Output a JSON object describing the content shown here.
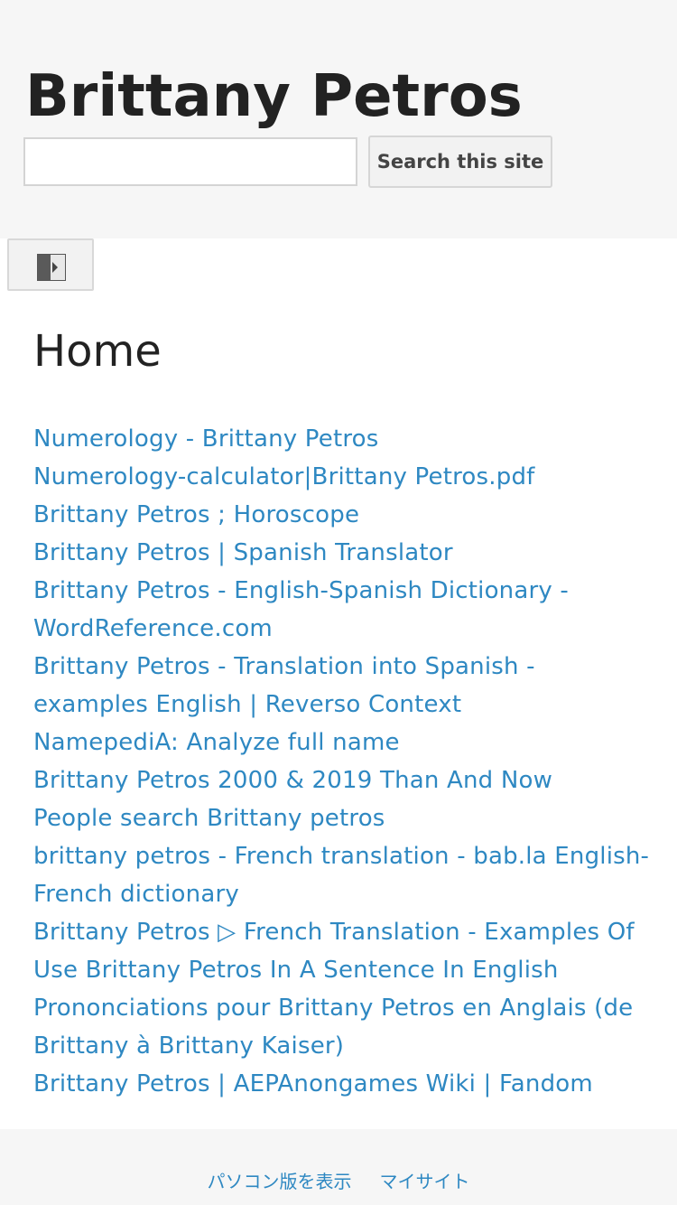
{
  "site": {
    "title": "Brittany Petros"
  },
  "search": {
    "value": "",
    "placeholder": "",
    "button_label": "Search this site"
  },
  "sidebar_toggle": {
    "icon": "sidebar-expand-icon"
  },
  "page": {
    "heading": "Home"
  },
  "links": [
    "Numerology - Brittany Petros",
    "Numerology-calculator|Brittany Petros.pdf",
    "Brittany Petros ; Horoscope",
    "Brittany Petros | Spanish Translator",
    "Brittany Petros - English-Spanish Dictionary - WordReference.com",
    "Brittany Petros - Translation into Spanish - examples English | Reverso Context",
    "NamepediA: Analyze full name",
    "Brittany Petros 2000 & 2019 Than And Now",
    "People search Brittany petros",
    "brittany petros - French translation - bab.la English-French dictionary",
    "Brittany Petros ▷ French Translation - Examples Of Use Brittany Petros In A Sentence In English",
    "Prononciations pour Brittany Petros en Anglais (de Brittany à Brittany Kaiser)",
    "Brittany Petros | AEPAnongames Wiki | Fandom"
  ],
  "footer": {
    "pc_version_label": "パソコン版を表示",
    "my_site_label": "マイサイト"
  },
  "colors": {
    "link": "#2e88c2",
    "header_bg": "#f6f6f6",
    "title": "#222222"
  }
}
